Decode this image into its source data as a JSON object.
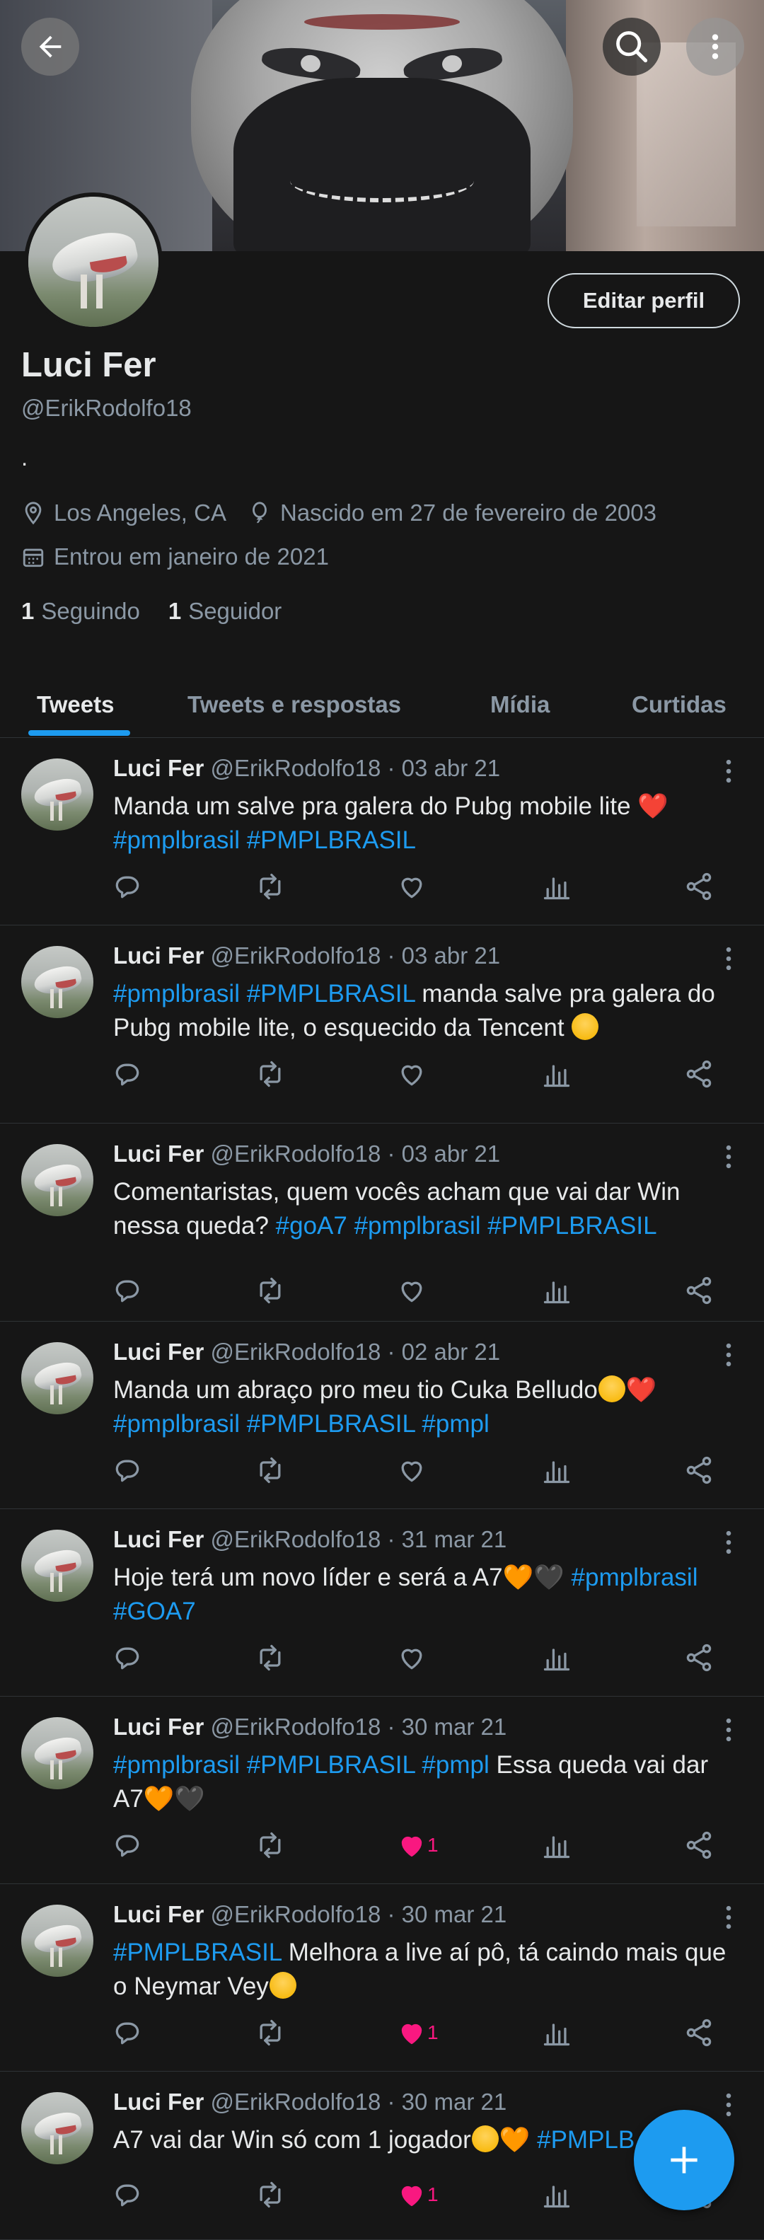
{
  "profile": {
    "name": "Luci Fer",
    "handle": "@ErikRodolfo18",
    "bio": ".",
    "location": "Los Angeles, CA",
    "birth": "Nascido em 27 de fevereiro de 2003",
    "joined": "Entrou em janeiro de 2021",
    "following_count": "1",
    "following_label": "Seguindo",
    "followers_count": "1",
    "followers_label": "Seguidor",
    "edit_button": "Editar perfil"
  },
  "tabs": [
    "Tweets",
    "Tweets e respostas",
    "Mídia",
    "Curtidas"
  ],
  "icons": {
    "back": "arrow-left-icon",
    "search": "search-icon",
    "more": "more-vertical-icon",
    "location": "location-pin-icon",
    "birthday": "balloon-icon",
    "calendar": "calendar-icon",
    "compose": "plus-icon"
  },
  "colors": {
    "background": "#161616",
    "accent": "#1d9bf0",
    "like": "#f91880",
    "muted": "#8b98a5"
  },
  "tweets": [
    {
      "name": "Luci Fer",
      "handle": "@ErikRodolfo18",
      "date": "· 03 abr 21",
      "parts": [
        {
          "t": "Manda um salve pra galera do Pubg mobile lite "
        },
        {
          "t": "❤️",
          "cls": "heart-emoji"
        },
        {
          "t": "\n"
        },
        {
          "t": "#pmplbrasil",
          "tag": true
        },
        {
          "t": " "
        },
        {
          "t": "#PMPLBRASIL",
          "tag": true
        }
      ],
      "likes": ""
    },
    {
      "name": "Luci Fer",
      "handle": "@ErikRodolfo18",
      "date": "· 03 abr 21",
      "parts": [
        {
          "t": "#pmplbrasil",
          "tag": true
        },
        {
          "t": " "
        },
        {
          "t": "#PMPLBRASIL",
          "tag": true
        },
        {
          "t": " manda salve pra galera do Pubg mobile lite, o esquecido da Tencent "
        },
        {
          "t": "😔",
          "emo": "pensive"
        }
      ],
      "likes": ""
    },
    {
      "name": "Luci Fer",
      "handle": "@ErikRodolfo18",
      "date": "· 03 abr 21",
      "parts": [
        {
          "t": "Comentaristas, quem vocês acham que vai dar Win nessa queda? "
        },
        {
          "t": "#goA7",
          "tag": true
        },
        {
          "t": " "
        },
        {
          "t": "#pmplbrasil",
          "tag": true
        },
        {
          "t": "  "
        },
        {
          "t": "#PMPLBRASIL",
          "tag": true
        }
      ],
      "likes": ""
    },
    {
      "name": "Luci Fer",
      "handle": "@ErikRodolfo18",
      "date": "· 02 abr 21",
      "parts": [
        {
          "t": "Manda um abraço pro meu tio Cuka Belludo"
        },
        {
          "t": "😳",
          "emo": "flush"
        },
        {
          "t": "❤️",
          "cls": "heart-emoji"
        },
        {
          "t": "\n"
        },
        {
          "t": "#pmplbrasil",
          "tag": true
        },
        {
          "t": " "
        },
        {
          "t": "#PMPLBRASIL",
          "tag": true
        },
        {
          "t": " "
        },
        {
          "t": "#pmpl",
          "tag": true
        }
      ],
      "likes": ""
    },
    {
      "name": "Luci Fer",
      "handle": "@ErikRodolfo18",
      "date": "· 31 mar 21",
      "parts": [
        {
          "t": "Hoje terá um novo líder e será a A7"
        },
        {
          "t": "🧡",
          "cls": "orange-heart"
        },
        {
          "t": "🖤",
          "cls": "black-heart"
        },
        {
          "t": " "
        },
        {
          "t": "#pmplbrasil",
          "tag": true
        },
        {
          "t": "\n"
        },
        {
          "t": "#GOA7",
          "tag": true
        }
      ],
      "likes": ""
    },
    {
      "name": "Luci Fer",
      "handle": "@ErikRodolfo18",
      "date": "· 30 mar 21",
      "parts": [
        {
          "t": "#pmplbrasil",
          "tag": true
        },
        {
          "t": "  "
        },
        {
          "t": "#PMPLBRASIL",
          "tag": true
        },
        {
          "t": " "
        },
        {
          "t": "#pmpl",
          "tag": true
        },
        {
          "t": " Essa queda vai dar A7"
        },
        {
          "t": "🧡",
          "cls": "orange-heart"
        },
        {
          "t": "🖤",
          "cls": "black-heart"
        }
      ],
      "likes": "1"
    },
    {
      "name": "Luci Fer",
      "handle": "@ErikRodolfo18",
      "date": "· 30 mar 21",
      "parts": [
        {
          "t": "#PMPLBRASIL",
          "tag": true
        },
        {
          "t": " Melhora a live aí pô, tá caindo mais que o Neymar Vey"
        },
        {
          "t": "😔",
          "emo": "pensive"
        }
      ],
      "likes": "1"
    },
    {
      "name": "Luci Fer",
      "handle": "@ErikRodolfo18",
      "date": "· 30 mar 21",
      "parts": [
        {
          "t": "A7 vai dar Win só com 1 jogador"
        },
        {
          "t": "😳",
          "emo": "flush"
        },
        {
          "t": "🧡",
          "cls": "orange-heart"
        },
        {
          "t": " "
        },
        {
          "t": "#PMPLB",
          "tag": true
        }
      ],
      "likes": "1"
    }
  ]
}
